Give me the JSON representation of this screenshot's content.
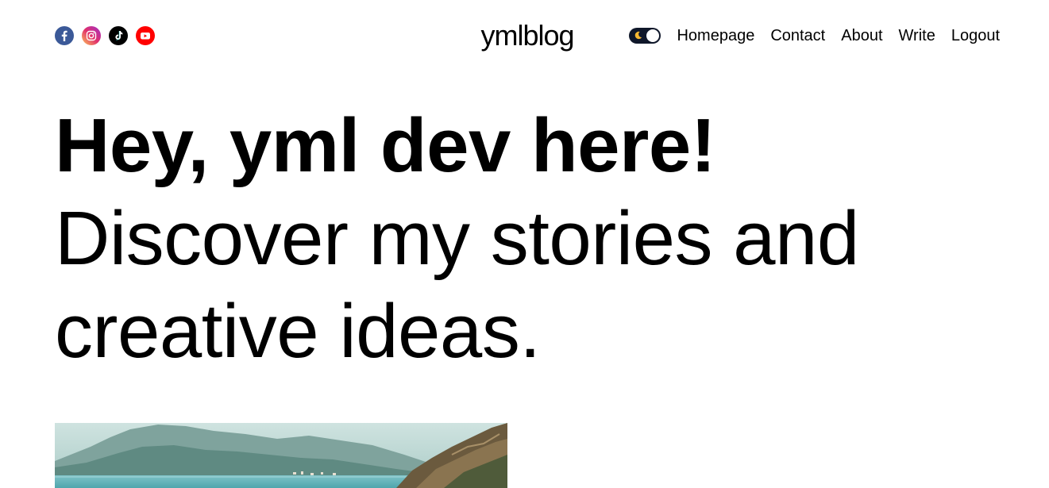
{
  "header": {
    "logo": "ymlblog",
    "social": [
      {
        "icon": "facebook-icon",
        "color": "#3b5998"
      },
      {
        "icon": "instagram-icon",
        "color": "#d6249f"
      },
      {
        "icon": "tiktok-icon",
        "color": "#000000"
      },
      {
        "icon": "youtube-icon",
        "color": "#ff0000"
      }
    ],
    "theme_toggle": {
      "icon": "moon-icon",
      "background": "#0f172a"
    },
    "nav": [
      {
        "label": "Homepage"
      },
      {
        "label": "Contact"
      },
      {
        "label": "About"
      },
      {
        "label": "Write"
      },
      {
        "label": "Logout"
      }
    ]
  },
  "hero": {
    "title": "Hey, yml dev here!",
    "subtitle_line1": "Discover my stories and",
    "subtitle_line2": "creative ideas."
  },
  "featured": {
    "image": "coastal-landscape-image"
  }
}
